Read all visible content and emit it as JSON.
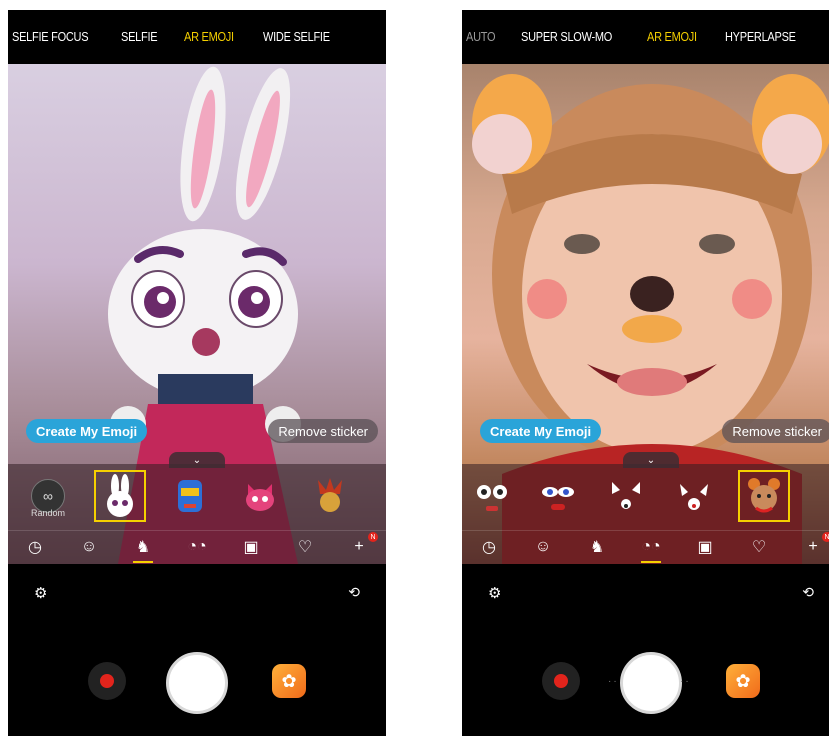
{
  "left": {
    "modes": [
      {
        "label": "SELFIE FOCUS",
        "state": "normal"
      },
      {
        "label": "SELFIE",
        "state": "normal"
      },
      {
        "label": "AR EMOJI",
        "state": "active"
      },
      {
        "label": "WIDE SELFIE",
        "state": "normal"
      }
    ],
    "create_label": "Create My Emoji",
    "remove_label": "Remove sticker",
    "random_label": "Random",
    "stickers": [
      "rabbit-emoji",
      "blue-robot-emoji",
      "pink-cat-emoji",
      "jester-mask-emoji"
    ],
    "selected_sticker": "rabbit-emoji",
    "categories": [
      "clock-icon",
      "avatar-icon",
      "rabbit-icon",
      "face-mask-icon",
      "picture-icon",
      "signature-icon",
      "add-icon"
    ],
    "active_category": "rabbit-icon",
    "new_badge": "N"
  },
  "right": {
    "modes": [
      {
        "label": "AUTO",
        "state": "faded"
      },
      {
        "label": "SUPER SLOW-MO",
        "state": "normal"
      },
      {
        "label": "AR EMOJI",
        "state": "active"
      },
      {
        "label": "HYPERLAPSE",
        "state": "normal"
      }
    ],
    "create_label": "Create My Emoji",
    "remove_label": "Remove sticker",
    "stickers": [
      "round-eyes-face",
      "sleepy-eyes-face",
      "white-cat-face",
      "deer-face",
      "bear-dog-face"
    ],
    "selected_sticker": "bear-dog-face",
    "categories": [
      "clock-icon",
      "avatar-icon",
      "rabbit-icon",
      "face-mask-icon",
      "picture-icon",
      "signature-icon",
      "add-icon"
    ],
    "active_category": "face-mask-icon",
    "new_badge": "N"
  },
  "colors": {
    "accent": "#f5d000",
    "create_pill": "#2aa4d9",
    "record": "#e2241c",
    "gallery": "#f06a1a"
  }
}
